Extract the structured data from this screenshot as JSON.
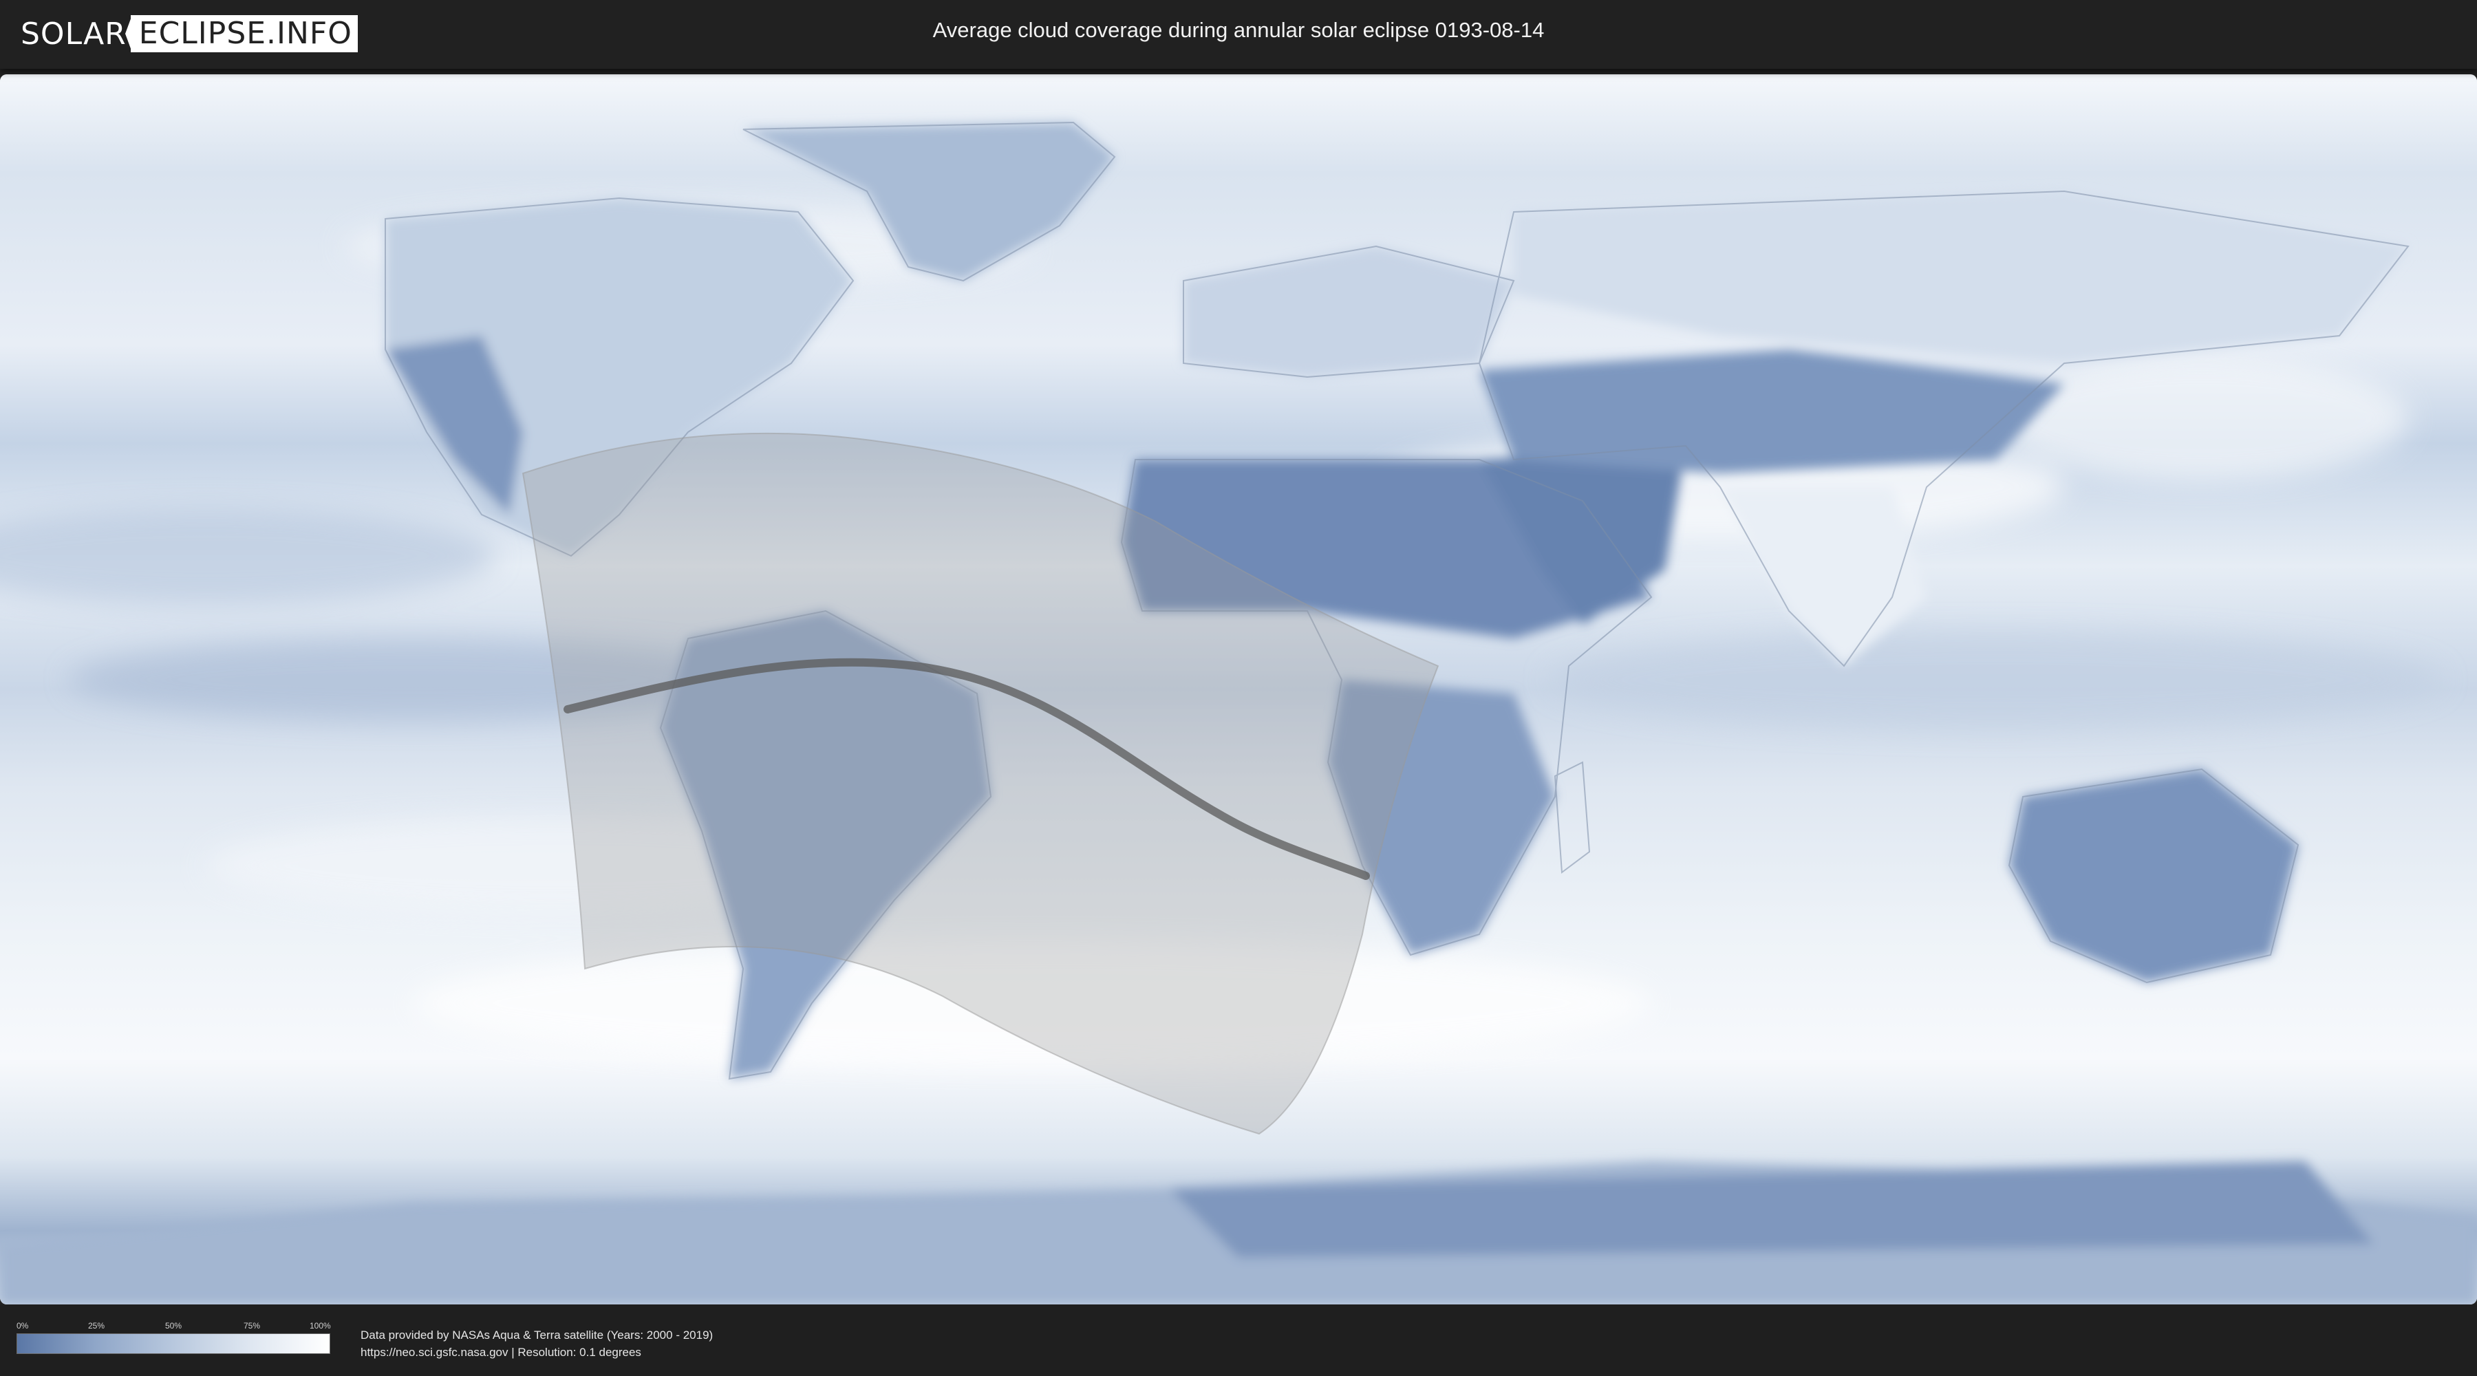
{
  "header": {
    "logo_part1": "SOLAR",
    "logo_part2": "ECLIPSE.INFO",
    "title": "Average cloud coverage during annular solar eclipse 0193-08-14"
  },
  "map": {
    "layer": "cloud-coverage",
    "colors": {
      "clear": "#5a77a6",
      "mid": "#b8c8de",
      "cloudy": "#ffffff",
      "eclipse_zone": "#bdbdbd",
      "central_line": "#555555"
    }
  },
  "legend": {
    "ticks": [
      "0%",
      "25%",
      "50%",
      "75%",
      "100%"
    ]
  },
  "credits": {
    "line1": "Data provided by NASAs Aqua & Terra satellite (Years: 2000 - 2019)",
    "line2": "https://neo.sci.gsfc.nasa.gov | Resolution: 0.1 degrees"
  }
}
